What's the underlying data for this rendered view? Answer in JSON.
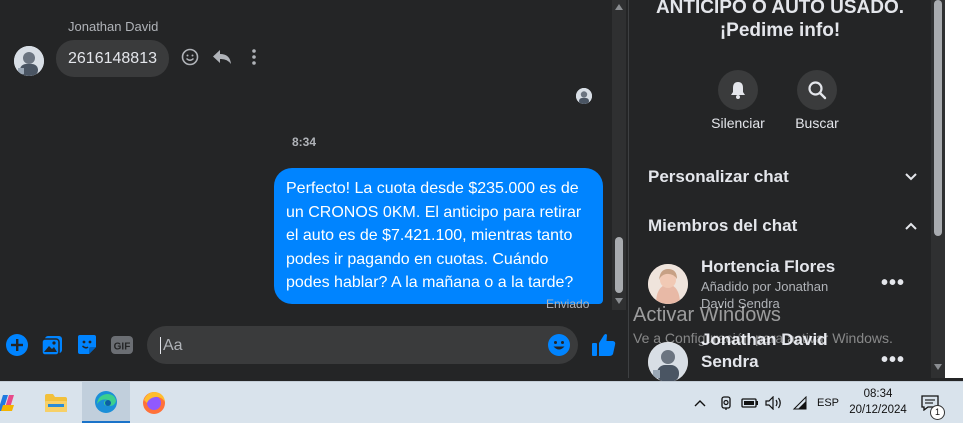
{
  "chat": {
    "sender_name": "Jonathan David",
    "incoming_message": "2616148813",
    "timestamp": "8:34",
    "outgoing_message": "Perfecto! La cuota desde $235.000 es de un CRONOS 0KM. El anticipo para retirar el auto es de $7.421.100, mientras tanto podes ir pagando en cuotas. Cuándo podes hablar? A la mañana o a la tarde?",
    "sent_status": "Enviado",
    "composer_placeholder": "Aa"
  },
  "panel": {
    "title_line1": "ANTICIPO O AUTO USADO.",
    "title_line2": "¡Pedime info!",
    "mute_label": "Silenciar",
    "search_label": "Buscar",
    "customize_label": "Personalizar chat",
    "members_label": "Miembros del chat",
    "members": [
      {
        "name": "Hortencia Flores",
        "subtitle": "Añadido por Jonathan David Sendra"
      },
      {
        "name": "Jonathan David Sendra",
        "subtitle": ""
      }
    ]
  },
  "watermark": {
    "title": "Activar Windows",
    "subtitle": "Ve a Configuración para activar Windows."
  },
  "taskbar": {
    "language": "ESP",
    "time": "08:34",
    "date": "20/12/2024",
    "notification_count": "1"
  },
  "colors": {
    "messenger_blue": "#0084ff",
    "chat_bg": "#242526",
    "bubble_incoming": "#3a3b3c",
    "taskbar_bg": "#d9e3ec"
  }
}
